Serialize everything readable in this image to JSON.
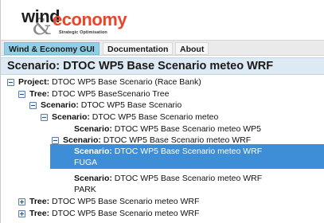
{
  "logo": {
    "word1": "wind",
    "word2": "economy",
    "ampersand": "&",
    "tagline": "Strategic Optimisation"
  },
  "tabs": [
    {
      "label": "Wind & Economy GUI",
      "active": true
    },
    {
      "label": "Documentation",
      "active": false
    },
    {
      "label": "About",
      "active": false
    }
  ],
  "page_title": "Scenario: DTOC WP5 Base Scenario meteo WRF",
  "tree": [
    {
      "type_label": "Project:",
      "name": " DTOC WP5 Base Scenario (Race Bank)",
      "toggle": "minus"
    },
    {
      "type_label": "Tree:",
      "name": " DTOC WP5 BaseScenario Tree",
      "toggle": "minus"
    },
    {
      "type_label": "Scenario:",
      "name": " DTOC WP5 Base Scenario",
      "toggle": "minus"
    },
    {
      "type_label": "Scenario:",
      "name": " DTOC WP5 Base Scenario meteo",
      "toggle": "minus"
    },
    {
      "type_label": "Scenario:",
      "name": " DTOC WP5 Base Scenario meteo WP5",
      "toggle": "none"
    },
    {
      "type_label": "Scenario:",
      "name": " DTOC WP5 Base Scenario meteo WRF",
      "toggle": "minus"
    },
    {
      "type_label": "Scenario:",
      "name": " DTOC WP5 Base Scenario meteo WRF",
      "name_line2": "FUGA",
      "toggle": "none",
      "selected": true
    },
    {
      "type_label": "Scenario:",
      "name": " DTOC WP5 Base Scenario meteo WRF",
      "name_line2": "PARK",
      "toggle": "none"
    },
    {
      "type_label": "Tree:",
      "name": " DTOC WP5 Base Scenario meteo WRF",
      "toggle": "plus"
    },
    {
      "type_label": "Tree:",
      "name": " DTOC WP5 Base Scenario meteo WRF",
      "toggle": "plus"
    }
  ],
  "colors": {
    "logo_accent": "#e8462a",
    "active_tab": "#8fd0e8",
    "title_bg": "#dde9f3",
    "selected_row": "#3d8ed6"
  }
}
